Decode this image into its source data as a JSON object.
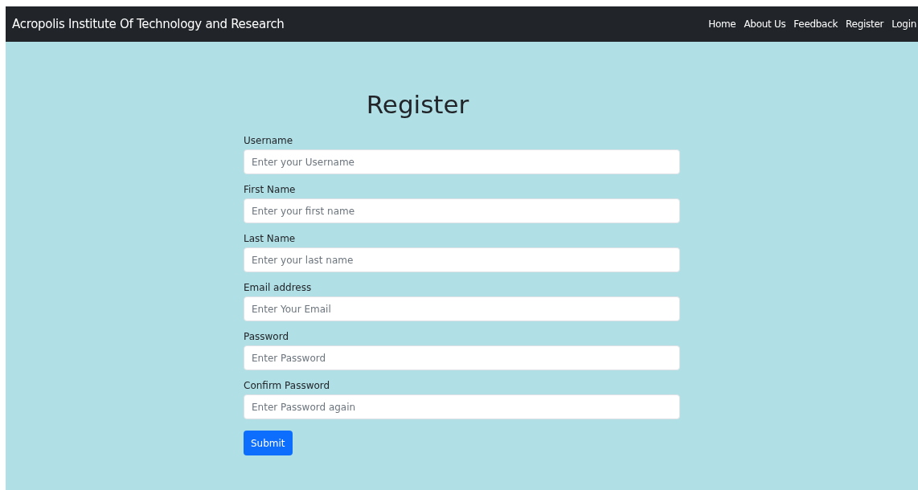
{
  "navbar": {
    "brand": "Acropolis Institute Of Technology and Research",
    "links": [
      {
        "label": "Home"
      },
      {
        "label": "About Us"
      },
      {
        "label": "Feedback"
      },
      {
        "label": "Register"
      },
      {
        "label": "Login"
      }
    ]
  },
  "form": {
    "title": "Register",
    "fields": [
      {
        "label": "Username",
        "placeholder": "Enter your Username"
      },
      {
        "label": "First Name",
        "placeholder": "Enter your first name"
      },
      {
        "label": "Last Name",
        "placeholder": "Enter your last name"
      },
      {
        "label": "Email address",
        "placeholder": "Enter Your Email"
      },
      {
        "label": "Password",
        "placeholder": "Enter Password"
      },
      {
        "label": "Confirm Password",
        "placeholder": "Enter Password again"
      }
    ],
    "submit": "Submit"
  }
}
